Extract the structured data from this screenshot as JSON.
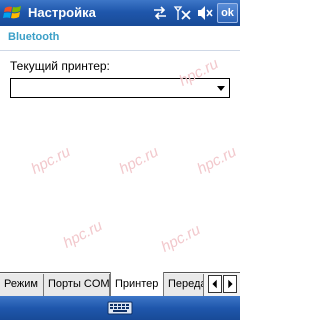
{
  "titlebar": {
    "title": "Настройка",
    "ok_label": "ok",
    "icons": [
      "windows-start-icon",
      "connectivity-icon",
      "signal-off-icon",
      "volume-muted-icon"
    ]
  },
  "heading": "Bluetooth",
  "printer": {
    "label": "Текущий принтер:",
    "value": ""
  },
  "watermark": "hpc.ru",
  "tabs": [
    {
      "label": "Режим",
      "active": false
    },
    {
      "label": "Порты COM",
      "active": false
    },
    {
      "label": "Принтер",
      "active": true
    },
    {
      "label": "Переда",
      "active": false
    }
  ],
  "colors": {
    "titlebar": "#1f57ac",
    "heading": "#3b9fc7",
    "watermark": "#f2c8cc"
  }
}
